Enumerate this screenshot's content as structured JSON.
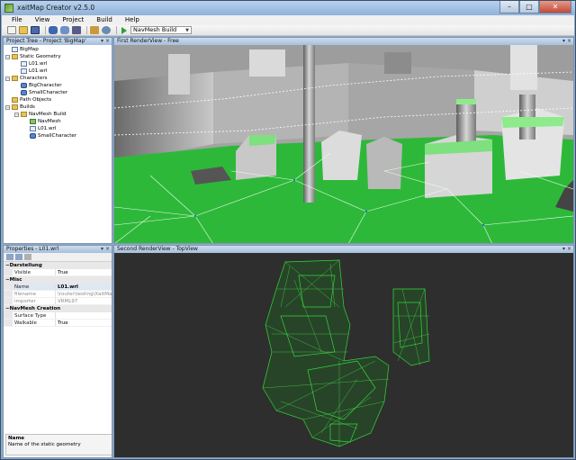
{
  "window": {
    "title": "xaitMap Creator v2.5.0",
    "minimize": "–",
    "maximize": "□",
    "close": "✕"
  },
  "menu": [
    {
      "label": "File"
    },
    {
      "label": "View"
    },
    {
      "label": "Project"
    },
    {
      "label": "Build"
    },
    {
      "label": "Help"
    }
  ],
  "toolbar": {
    "build_target": "NavMesh Build",
    "icons": [
      "new-icon",
      "open-icon",
      "save-icon",
      "characters-icon",
      "settings-icon",
      "tool-icon",
      "export-icon",
      "search-icon",
      "play-icon"
    ]
  },
  "project_tree": {
    "title": "Project Tree - Project 'BigMap'",
    "items": [
      {
        "label": "BigMap",
        "depth": 0,
        "icon": "map-icon"
      },
      {
        "label": "Static Geometry",
        "depth": 0,
        "icon": "folder-icon"
      },
      {
        "label": "L01.wrl",
        "depth": 1,
        "icon": "geometry-file-icon"
      },
      {
        "label": "L01.wrl",
        "depth": 1,
        "icon": "geometry-file-icon"
      },
      {
        "label": "Characters",
        "depth": 0,
        "icon": "folder-icon"
      },
      {
        "label": "BigCharacter",
        "depth": 1,
        "icon": "character-icon"
      },
      {
        "label": "SmallCharacter",
        "depth": 1,
        "icon": "character-icon"
      },
      {
        "label": "Path Objects",
        "depth": 0,
        "icon": "folder-icon"
      },
      {
        "label": "Builds",
        "depth": 0,
        "icon": "folder-icon"
      },
      {
        "label": "NavMesh Build",
        "depth": 1,
        "icon": "folder-icon"
      },
      {
        "label": "NavMesh",
        "depth": 2,
        "icon": "navmesh-icon"
      },
      {
        "label": "L01.wrl",
        "depth": 2,
        "icon": "geometry-file-icon"
      },
      {
        "label": "SmallCharacter",
        "depth": 2,
        "icon": "character-icon"
      }
    ]
  },
  "properties": {
    "title": "Properties - L01.wrl",
    "sections": [
      {
        "name": "Darstellung",
        "rows": [
          {
            "name": "Visible",
            "value": "True",
            "dim": false,
            "bold": false
          }
        ]
      },
      {
        "name": "Misc",
        "rows": [
          {
            "name": "Name",
            "value": "L01.wrl",
            "dim": false,
            "bold": true,
            "selected": true
          },
          {
            "name": "filename",
            "value": "\\router\\testing\\XaitMap\\x",
            "dim": true,
            "bold": false
          },
          {
            "name": "importer",
            "value": "VRML97",
            "dim": true,
            "bold": false
          }
        ]
      },
      {
        "name": "NavMesh Creation",
        "rows": [
          {
            "name": "Surface Type",
            "value": "",
            "dim": false,
            "bold": false
          },
          {
            "name": "Walkable",
            "value": "True",
            "dim": false,
            "bold": false
          }
        ]
      }
    ],
    "description_title": "Name",
    "description_text": "Name of the static geometry"
  },
  "first_view": {
    "title": "First RenderView - Free"
  },
  "second_view": {
    "title": "Second RenderView - TopView"
  },
  "colors": {
    "navmesh_green": "#2eb83a",
    "mesh_wire": "#33d63a",
    "topview_bg": "#2e2e2e",
    "chrome_blue": "#8aa9c9"
  }
}
